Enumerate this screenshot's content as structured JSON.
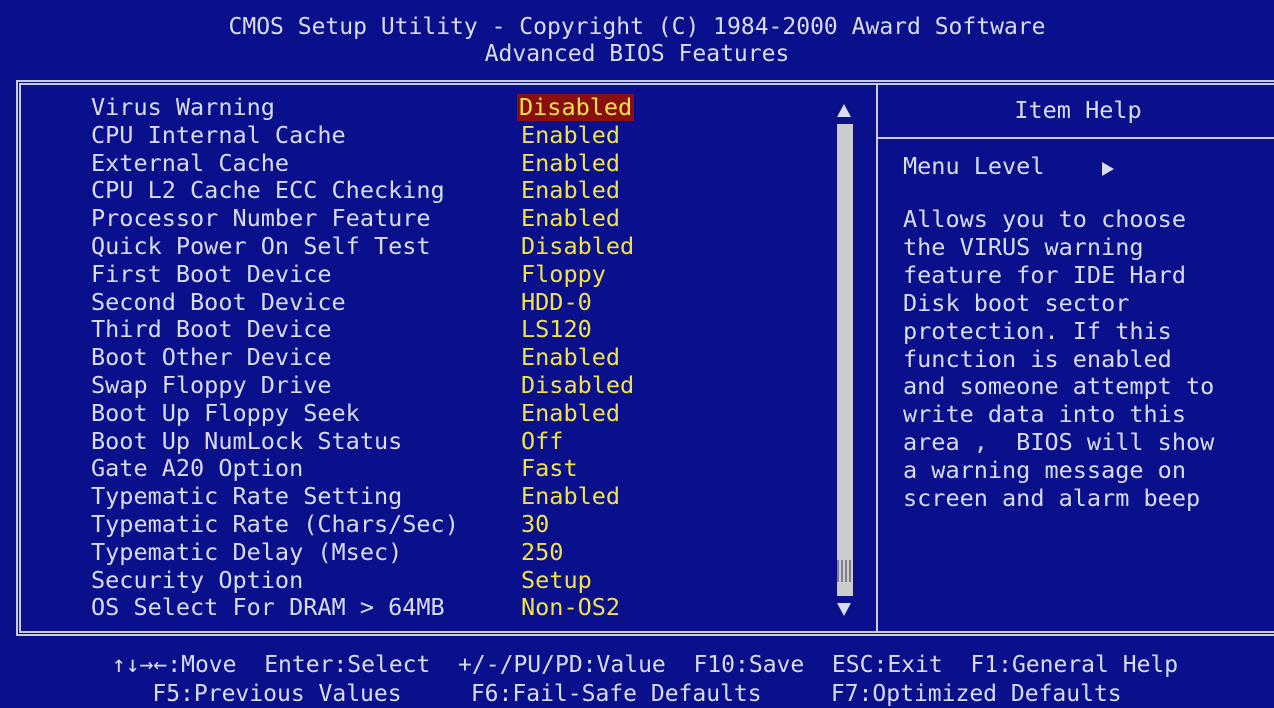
{
  "header": {
    "title": "CMOS Setup Utility - Copyright (C) 1984-2000 Award Software",
    "subtitle": "Advanced BIOS Features"
  },
  "settings": [
    {
      "label": "Virus Warning",
      "value": "Disabled",
      "selected": true
    },
    {
      "label": "CPU Internal Cache",
      "value": "Enabled"
    },
    {
      "label": "External Cache",
      "value": "Enabled"
    },
    {
      "label": "CPU L2 Cache ECC Checking",
      "value": "Enabled"
    },
    {
      "label": "Processor Number Feature",
      "value": "Enabled"
    },
    {
      "label": "Quick Power On Self Test",
      "value": "Disabled"
    },
    {
      "label": "First Boot Device",
      "value": "Floppy"
    },
    {
      "label": "Second Boot Device",
      "value": "HDD-0"
    },
    {
      "label": "Third Boot Device",
      "value": "LS120"
    },
    {
      "label": "Boot Other Device",
      "value": "Enabled"
    },
    {
      "label": "Swap Floppy Drive",
      "value": "Disabled"
    },
    {
      "label": "Boot Up Floppy Seek",
      "value": "Enabled"
    },
    {
      "label": "Boot Up NumLock Status",
      "value": "Off"
    },
    {
      "label": "Gate A20 Option",
      "value": "Fast"
    },
    {
      "label": "Typematic Rate Setting",
      "value": "Enabled"
    },
    {
      "label": "Typematic Rate (Chars/Sec)",
      "value": "30"
    },
    {
      "label": "Typematic Delay (Msec)",
      "value": "250"
    },
    {
      "label": "Security Option",
      "value": "Setup"
    },
    {
      "label": "OS Select For DRAM > 64MB",
      "value": "Non-OS2"
    }
  ],
  "help": {
    "title": "Item Help",
    "menu_level": "Menu Level",
    "lines": [
      "Allows you to choose",
      "the VIRUS warning",
      "feature for IDE Hard",
      "Disk boot sector",
      "protection. If this",
      "function is enabled",
      "and someone attempt to",
      "write data into this",
      "area ,  BIOS will show",
      "a warning message on",
      "screen and alarm beep"
    ]
  },
  "footer": {
    "line1": "↑↓→←:Move  Enter:Select  +/-/PU/PD:Value  F10:Save  ESC:Exit  F1:General Help",
    "line2": "F5:Previous Values     F6:Fail-Safe Defaults     F7:Optimized Defaults"
  },
  "icons": {
    "scroll_up": "triangle-up-icon",
    "scroll_down": "triangle-down-icon",
    "menu_level_arrow": "triangle-right-icon"
  },
  "colors": {
    "background": "#0a0f8c",
    "value_text": "#f0e248",
    "label_text": "#d8dcec",
    "selection": "#8a0f10"
  }
}
